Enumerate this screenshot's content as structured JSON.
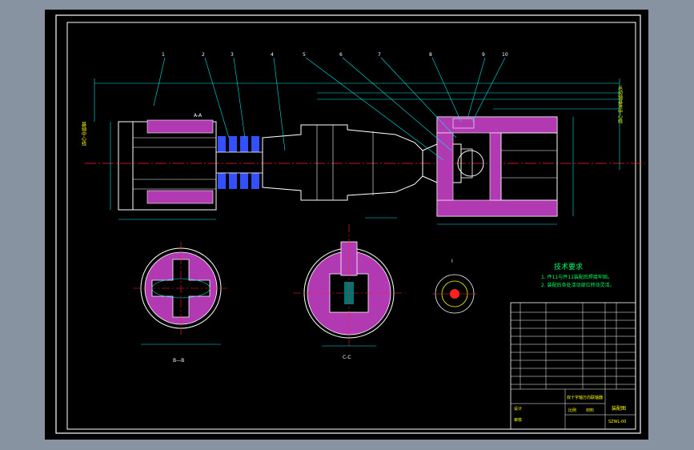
{
  "app": {
    "background_color": "#8793a1",
    "canvas_color": "#000000"
  },
  "drawing": {
    "colors": {
      "outline": "#ffffff",
      "hatch": "#b13ab3",
      "dimension": "#00e5e5",
      "centerline": "#ff2020",
      "border": "#ffffff",
      "text_yellow": "#ffff00",
      "text_green": "#00ff66",
      "blue_part": "#3350ff"
    },
    "leader_numbers": [
      "1",
      "2",
      "3",
      "4",
      "5",
      "6",
      "7",
      "8",
      "9",
      "10"
    ],
    "section_labels": {
      "main": "A-A",
      "section_left": "B—B",
      "section_center": "C-C",
      "detail": "I"
    },
    "tech_requirements": {
      "title": "技术要求",
      "line1": "1. 件11与件11装配后焊接牢固。",
      "line2": "2. 装配后各处活动部位转动灵活。"
    },
    "side_note_left": "基轴中心线",
    "side_note_right": "从动轴基准中心线",
    "title_block": {
      "name": "双十字轴万向联轴器",
      "drawing_no": "SZWL-00",
      "scale_label": "比例",
      "material_label": "材料",
      "designer_label": "设计",
      "checker_label": "审核",
      "title_cell": "装配图"
    }
  }
}
